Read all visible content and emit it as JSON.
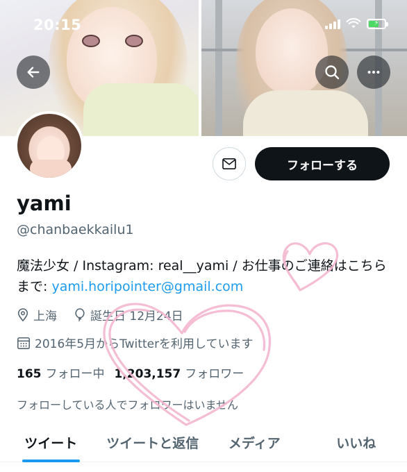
{
  "status_bar": {
    "time": "20:15"
  },
  "header": {
    "back_label": "back",
    "search_label": "search",
    "more_label": "more"
  },
  "profile": {
    "display_name": "yami",
    "handle": "@chanbaekkailu1",
    "bio_text": "魔法少女 / Instagram: real__yami / お仕事のご連絡はこちらまで: ",
    "bio_email": "yami.horipointer@gmail.com",
    "location": "上海",
    "birthday": "誕生日 12月24日",
    "joined": "2016年5月からTwitterを利用しています",
    "following_count": "165",
    "following_label": "フォロー中",
    "followers_count": "1,203,157",
    "followers_label": "フォロワー",
    "mutual_text": "フォローしている人でフォロワーはいません"
  },
  "actions": {
    "follow_label": "フォローする"
  },
  "tabs": [
    {
      "label": "ツイート",
      "active": true
    },
    {
      "label": "ツイートと返信",
      "active": false
    },
    {
      "label": "メディア",
      "active": false
    },
    {
      "label": "いいね",
      "active": false
    }
  ],
  "colors": {
    "accent": "#1d9bf0",
    "text_primary": "#0f1419",
    "text_secondary": "#536471",
    "follow_button": "#0f1419",
    "heart_doodle": "#f4b6cf"
  }
}
